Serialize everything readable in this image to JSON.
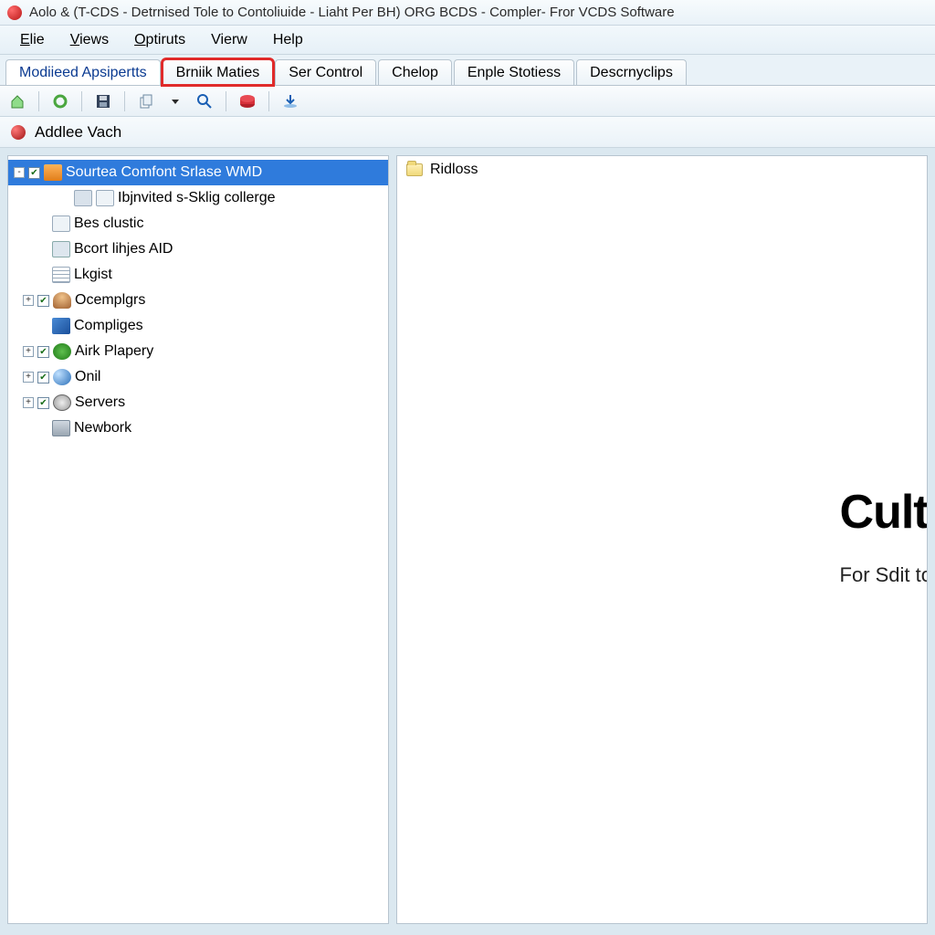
{
  "titlebar": {
    "title": "Aolo & (T-CDS - Detrnised Tole to Contoliuide - Liaht Per BH) ORG BCDS - Compler- Fror VCDS Software"
  },
  "menubar": {
    "items": [
      {
        "label": "Elie",
        "underline": "E"
      },
      {
        "label": "Views",
        "underline": "V"
      },
      {
        "label": "Optiruts",
        "underline": "O"
      },
      {
        "label": "Vierw",
        "underline": ""
      },
      {
        "label": "Help",
        "underline": ""
      }
    ]
  },
  "tabs": {
    "items": [
      {
        "label": "Modiieed Apsipertts",
        "active": true,
        "highlighted": false
      },
      {
        "label": "Brniik Maties",
        "active": false,
        "highlighted": true
      },
      {
        "label": "Ser Control",
        "active": false,
        "highlighted": false
      },
      {
        "label": "Chelop",
        "active": false,
        "highlighted": false
      },
      {
        "label": "Enple Stotiess",
        "active": false,
        "highlighted": false
      },
      {
        "label": "Descrnyclips",
        "active": false,
        "highlighted": false
      }
    ]
  },
  "subheader": {
    "title": "Addlee Vach"
  },
  "tree": {
    "root": {
      "label": "Sourtea Comfont Srlase WMD",
      "selected": true,
      "checked": true,
      "expander": "-",
      "indent": 0,
      "icon": "package-icon"
    },
    "nodes": [
      {
        "label": "Ibjnvited s-Sklig collerge",
        "checked": null,
        "expander": null,
        "indent": 3,
        "icon": "doc-icon",
        "icon2": "card-icon"
      },
      {
        "label": "Bes clustic",
        "checked": null,
        "expander": null,
        "indent": 1,
        "icon": "folder-plain-icon"
      },
      {
        "label": "Bcort lihjes AID",
        "checked": null,
        "expander": null,
        "indent": 1,
        "icon": "card-icon"
      },
      {
        "label": "Lkgist",
        "checked": null,
        "expander": null,
        "indent": 1,
        "icon": "list-icon"
      },
      {
        "label": "Ocemplgrs",
        "checked": true,
        "expander": "+",
        "indent": 0,
        "icon": "person-icon"
      },
      {
        "label": "Compliges",
        "checked": null,
        "expander": null,
        "indent": 1,
        "icon": "cube-icon"
      },
      {
        "label": "Airk Plapery",
        "checked": true,
        "expander": "+",
        "indent": 0,
        "icon": "leaf-icon"
      },
      {
        "label": "Onil",
        "checked": true,
        "expander": "+",
        "indent": 0,
        "icon": "globe-icon"
      },
      {
        "label": "Servers",
        "checked": true,
        "expander": "+",
        "indent": 0,
        "icon": "clock-icon"
      },
      {
        "label": "Newbork",
        "checked": null,
        "expander": null,
        "indent": 1,
        "icon": "device-icon"
      }
    ]
  },
  "detail": {
    "header_label": "Ridloss",
    "big_heading": "Cult",
    "big_sub": "For Sdit to"
  }
}
